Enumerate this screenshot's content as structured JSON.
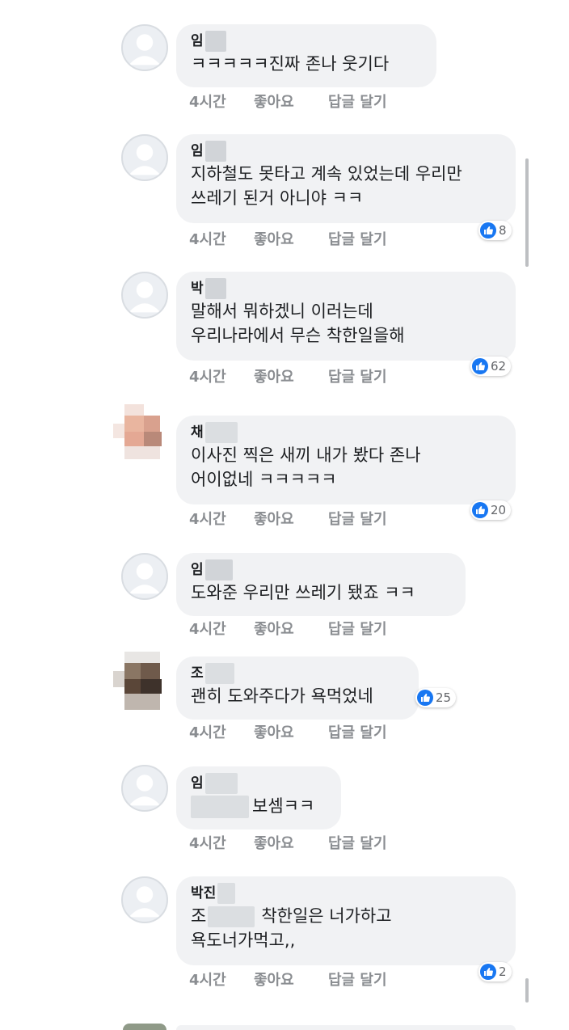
{
  "comments": [
    {
      "name": "임",
      "text": [
        "ㅋㅋㅋㅋㅋ진짜 존나 웃기다"
      ],
      "time": "4시간",
      "like": "좋아요",
      "reply": "답글 달기",
      "reactions": ""
    },
    {
      "name": "임",
      "text": [
        "지하철도 못타고 계속 있었는데 우리만",
        "쓰레기 된거 아니야 ㅋㅋ"
      ],
      "time": "4시간",
      "like": "좋아요",
      "reply": "답글 달기",
      "reactions": "8"
    },
    {
      "name": "박",
      "text": [
        "말해서 뭐하겠니 이러는데",
        "우리나라에서 무슨 착한일을해"
      ],
      "time": "4시간",
      "like": "좋아요",
      "reply": "답글 달기",
      "reactions": "62"
    },
    {
      "name": "채",
      "text": [
        "이사진 찍은 새끼 내가 봤다 존나",
        "어이없네 ㅋㅋㅋㅋㅋ"
      ],
      "time": "4시간",
      "like": "좋아요",
      "reply": "답글 달기",
      "reactions": "20"
    },
    {
      "name": "임",
      "text": [
        "도와준 우리만 쓰레기 됐죠 ㅋㅋ"
      ],
      "time": "4시간",
      "like": "좋아요",
      "reply": "답글 달기",
      "reactions": ""
    },
    {
      "name": "조",
      "text": [
        "괜히 도와주다가 욕먹었네"
      ],
      "time": "4시간",
      "like": "좋아요",
      "reply": "답글 달기",
      "reactions": "25"
    },
    {
      "name": "임",
      "text": [
        "보셈ㅋㅋ"
      ],
      "time": "4시간",
      "like": "좋아요",
      "reply": "답글 달기",
      "reactions": ""
    },
    {
      "name": "박진",
      "text": [
        "조",
        "착한일은 너가하고",
        "욕도너가먹고,,"
      ],
      "time": "4시간",
      "like": "좋아요",
      "reply": "답글 달기",
      "reactions": "2"
    }
  ],
  "colors": {
    "bubble": "#f1f2f4",
    "meta": "#8a8d91",
    "like_blue": "#1877f2"
  },
  "icons": {
    "avatar_default": "person-silhouette-icon",
    "reaction": "thumbs-up-icon"
  }
}
